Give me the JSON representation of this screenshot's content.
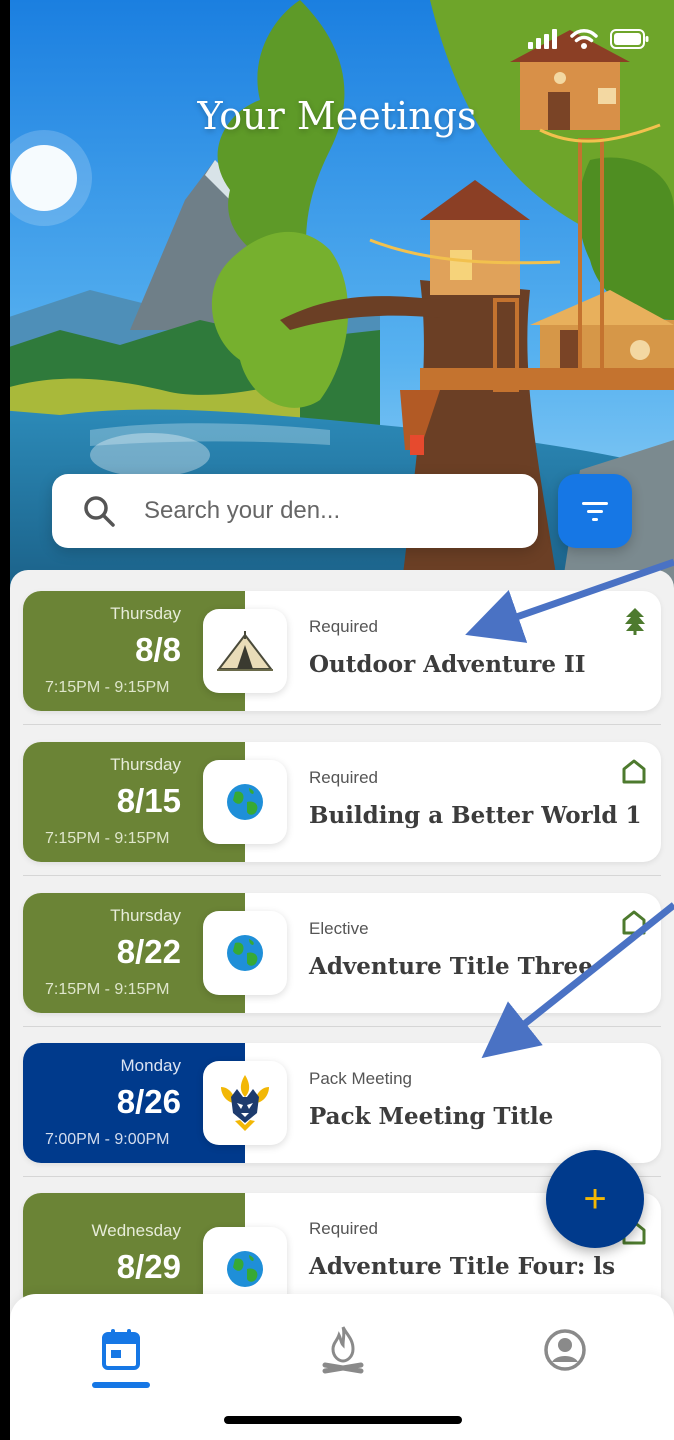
{
  "header": {
    "title": "Your Meetings"
  },
  "search": {
    "placeholder": "Search your den..."
  },
  "meetings": [
    {
      "day": "Thursday",
      "date": "8/8",
      "time": "7:15PM - 9:15PM",
      "type": "Required",
      "title": "Outdoor Adventure II",
      "icon": "tent-icon",
      "badge": "tree-icon",
      "color": "#6b8436"
    },
    {
      "day": "Thursday",
      "date": "8/15",
      "time": "7:15PM - 9:15PM",
      "type": "Required",
      "title": "Building a Better World 1",
      "icon": "globe-icon",
      "badge": "home-icon",
      "color": "#6b8436"
    },
    {
      "day": "Thursday",
      "date": "8/22",
      "time": "7:15PM - 9:15PM",
      "type": "Elective",
      "title": "Adventure Title Three",
      "icon": "globe-icon",
      "badge": "home-icon",
      "color": "#6b8436"
    },
    {
      "day": "Monday",
      "date": "8/26",
      "time": "7:00PM - 9:00PM",
      "type": "Pack Meeting",
      "title": "Pack Meeting Title",
      "icon": "cub-scout-emblem-icon",
      "badge": "",
      "color": "#003a8c"
    },
    {
      "day": "Wednesday",
      "date": "8/29",
      "time": "",
      "type": "Required",
      "title": "Adventure Title Four: ls",
      "icon": "globe-icon",
      "badge": "home-icon",
      "color": "#6b8436"
    }
  ],
  "fab": {
    "label": "+",
    "icon": "plus-icon"
  },
  "nav": {
    "items": [
      "calendar-icon",
      "campfire-icon",
      "profile-icon"
    ],
    "active": "calendar-icon"
  },
  "colors": {
    "accent": "#1677e5",
    "den": "#6b8436",
    "pack": "#003a8c",
    "fab_plus": "#f2b705"
  }
}
